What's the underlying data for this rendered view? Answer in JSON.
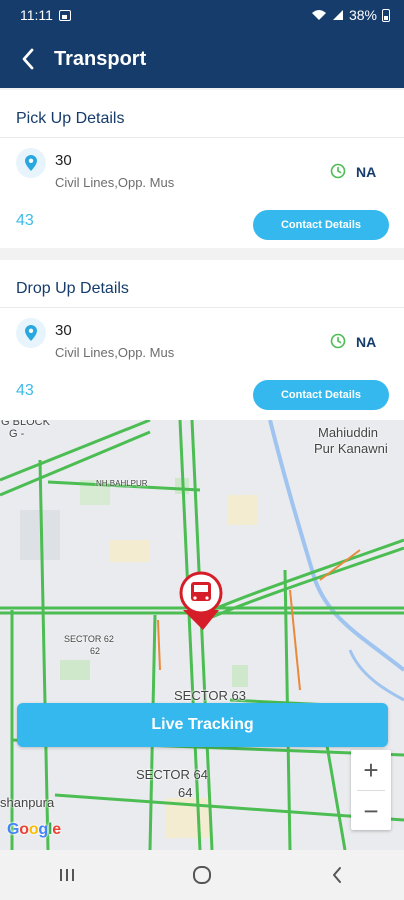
{
  "status": {
    "time": "11:11",
    "battery": "38%"
  },
  "appbar": {
    "title": "Transport"
  },
  "pickup": {
    "heading": "Pick Up Details",
    "stop_no": "30",
    "address": "Civil Lines,Opp. Mus",
    "time": "NA",
    "count": "43",
    "contact_label": "Contact Details"
  },
  "drop": {
    "heading": "Drop Up Details",
    "stop_no": "30",
    "address": "Civil Lines,Opp. Mus",
    "time": "NA",
    "count": "43",
    "contact_label": "Contact Details"
  },
  "map": {
    "labels": {
      "mahiuddin_1": "Mahiuddin",
      "mahiuddin_2": "Pur Kanawni",
      "sector62": "SECTOR 62",
      "sector62_num": "62",
      "sector63": "SECTOR 63",
      "sector64": "SECTOR 64",
      "sector64_num": "64",
      "shanpura": "shanpura",
      "noida_block": "G BLOCK",
      "noida_g": "G -",
      "nh_area": "NH BAHLPUR"
    },
    "live_tracking_label": "Live Tracking",
    "zoom_in": "+",
    "zoom_out": "−",
    "attribution": "Google"
  },
  "colors": {
    "primary": "#153c6b",
    "accent": "#35b8ee",
    "road_green": "#4cbd52"
  }
}
